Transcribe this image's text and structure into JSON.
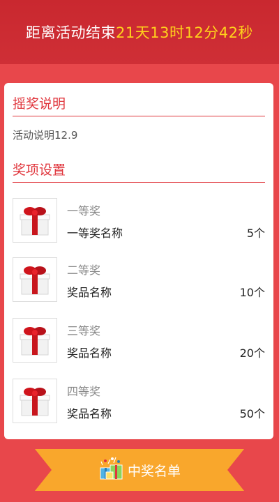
{
  "countdown": {
    "label": "距离活动结束",
    "time": "21天13时12分42秒"
  },
  "rules": {
    "title": "摇奖说明",
    "description": "活动说明12.9"
  },
  "prizes_section": {
    "title": "奖项设置",
    "items": [
      {
        "level": "一等奖",
        "name": "一等奖名称",
        "count": "5个",
        "icon": "gift-box-icon"
      },
      {
        "level": "二等奖",
        "name": "奖品名称",
        "count": "10个",
        "icon": "gift-box-icon"
      },
      {
        "level": "三等奖",
        "name": "奖品名称",
        "count": "20个",
        "icon": "gift-box-icon"
      },
      {
        "level": "四等奖",
        "name": "奖品名称",
        "count": "50个",
        "icon": "gift-box-icon"
      }
    ]
  },
  "winners_button": {
    "label": "中奖名单",
    "icon": "gifts-icon"
  },
  "colors": {
    "background": "#e8474b",
    "header": "#c9282f",
    "accent": "#e0353c",
    "countdown_time": "#ffd21c",
    "button": "#f9a72c"
  }
}
